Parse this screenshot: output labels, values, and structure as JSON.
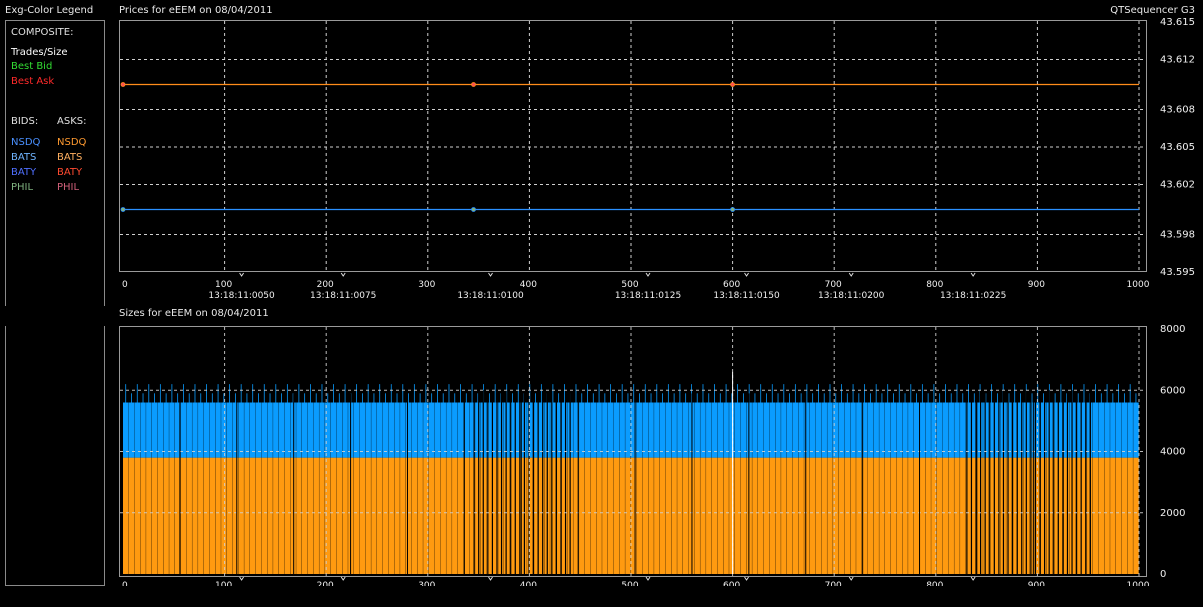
{
  "header": {
    "legend_title": "Exg-Color Legend",
    "prices_title": "Prices for  eEEM  on  08/04/2011",
    "app_name": "QTSequencer G3",
    "sizes_title": "Sizes for  eEEM  on  08/04/2011"
  },
  "legend": {
    "composite_label": "COMPOSITE:",
    "trades_size": "Trades/Size",
    "best_bid": "Best Bid",
    "best_ask": "Best Ask",
    "bids_label": "BIDS:",
    "asks_label": "ASKS:",
    "bids": [
      "NSDQ",
      "BATS",
      "BATY",
      "PHIL"
    ],
    "asks": [
      "NSDQ",
      "BATS",
      "BATY",
      "PHIL"
    ],
    "bid_colors": [
      "#4a90ff",
      "#6fb4ff",
      "#4f6fff",
      "#7fb27f"
    ],
    "ask_colors": [
      "#ff9a30",
      "#ffb060",
      "#ff4a30",
      "#d0607a"
    ],
    "trades_color": "#ffffff",
    "best_bid_color": "#33dd33",
    "best_ask_color": "#ff2a2a"
  },
  "colors": {
    "ask_line": "#ff8c1a",
    "bid_line": "#2a90ff",
    "ask_size": "#ff9a10",
    "bid_size": "#0a9cff",
    "grid": "#cfcfcf"
  },
  "chart_data": [
    {
      "type": "line",
      "title": "Prices for  eEEM  on  08/04/2011",
      "xlim": [
        0,
        1000
      ],
      "ylim": [
        43.595,
        43.615
      ],
      "x_ticks": [
        0,
        100,
        200,
        300,
        400,
        500,
        600,
        700,
        800,
        900,
        1000
      ],
      "y_ticks": [
        "43.615",
        "43.612",
        "43.608",
        "43.605",
        "43.602",
        "43.598",
        "43.595"
      ],
      "y_tick_values": [
        43.615,
        43.612,
        43.608,
        43.605,
        43.602,
        43.598,
        43.595
      ],
      "time_labels": [
        "13:18:11:0050",
        "13:18:11:0075",
        "13:18:11:0100",
        "13:18:11:0125",
        "13:18:11:0150",
        "13:18:11:0200",
        "13:18:11:0225"
      ],
      "time_label_x": [
        100,
        200,
        345,
        500,
        597,
        700,
        820
      ],
      "series": [
        {
          "values": [
            [
              0,
              43.61
            ],
            [
              345,
              43.61
            ],
            [
              600,
              43.61
            ],
            [
              1000,
              43.61
            ]
          ],
          "color": "#ff8c1a"
        },
        {
          "values": [
            [
              0,
              43.6
            ],
            [
              345,
              43.6
            ],
            [
              600,
              43.6
            ],
            [
              1000,
              43.6
            ]
          ],
          "color": "#2a90ff"
        }
      ],
      "grid": true
    },
    {
      "type": "bar",
      "title": "Sizes for  eEEM  on  08/04/2011",
      "xlim": [
        0,
        1000
      ],
      "ylim": [
        0,
        8000
      ],
      "x_ticks": [
        0,
        100,
        200,
        300,
        400,
        500,
        600,
        700,
        800,
        900,
        1000
      ],
      "y_ticks": [
        "8000",
        "6000",
        "4000",
        "2000",
        "0"
      ],
      "y_tick_values": [
        8000,
        6000,
        4000,
        2000,
        0
      ],
      "time_labels": [
        "13:18:11:0050",
        "13:18:11:0075",
        "13:18:11:0100",
        "13:18:11:0125",
        "13:18:11:0150",
        "13:18:11:0200",
        "13:18:11:0225"
      ],
      "time_label_x": [
        100,
        200,
        345,
        500,
        597,
        700,
        820
      ],
      "series": [
        {
          "values": [
            3800
          ],
          "color": "#ff9a10"
        },
        {
          "values": [
            1800
          ],
          "color": "#0a9cff"
        }
      ],
      "grid": true
    }
  ]
}
